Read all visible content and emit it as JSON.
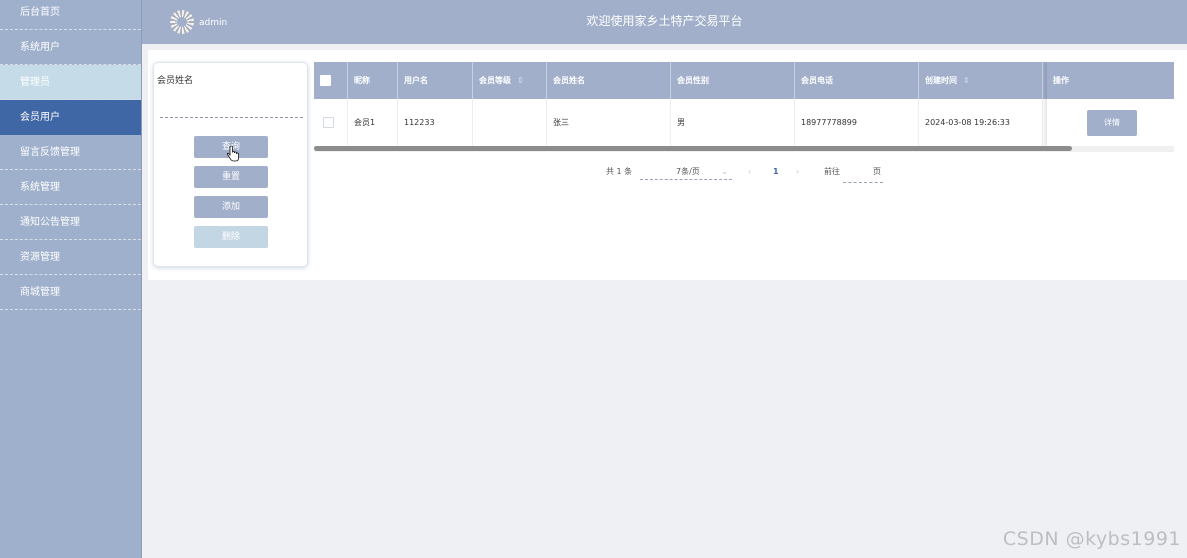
{
  "sidebar": {
    "items": [
      {
        "label": "后台首页"
      },
      {
        "label": "系统用户"
      },
      {
        "label": "管理员"
      },
      {
        "label": "会员用户"
      },
      {
        "label": "留言反馈管理"
      },
      {
        "label": "系统管理"
      },
      {
        "label": "通知公告管理"
      },
      {
        "label": "资源管理"
      },
      {
        "label": "商城管理"
      }
    ]
  },
  "header": {
    "user": "admin",
    "title": "欢迎使用家乡土特产交易平台"
  },
  "search": {
    "label": "会员姓名",
    "placeholder": "",
    "buttons": {
      "query": "查询",
      "reset": "重置",
      "add": "添加",
      "delete": "删除"
    }
  },
  "table": {
    "columns": [
      "昵称",
      "用户名",
      "会员等级",
      "会员姓名",
      "会员性别",
      "会员电话",
      "创建时间",
      "操作"
    ],
    "rows": [
      {
        "nickname": "会员1",
        "username": "112233",
        "level": "",
        "name": "张三",
        "gender": "男",
        "phone": "18977778899",
        "created": "2024-03-08 19:26:33",
        "action": "详情"
      }
    ]
  },
  "pagination": {
    "total": "共 1 条",
    "page_size": "7条/页",
    "current_page": "1",
    "goto_label": "前往",
    "page_unit": "页"
  },
  "watermark": "CSDN @kybs1991",
  "colors": {
    "sidebar": "#9fb0cc",
    "header": "#a1afcb",
    "active": "#3f67a6",
    "button": "#a1afcb"
  }
}
